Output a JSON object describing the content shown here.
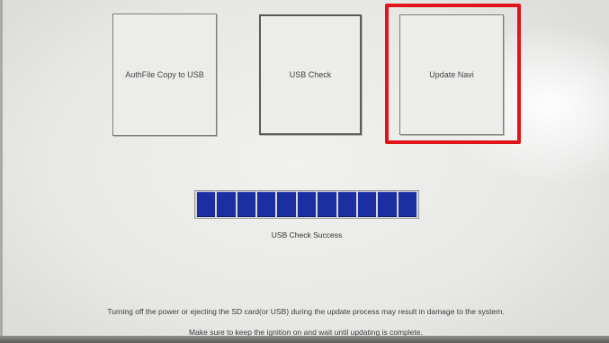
{
  "buttons": {
    "authfile_copy": "AuthFile Copy to USB",
    "usb_check": "USB Check",
    "update_navi": "Update Navi"
  },
  "progress": {
    "segments_filled": 11,
    "segments_total": 11,
    "fill_color": "#1c2fa0"
  },
  "status": {
    "message": "USB Check Success"
  },
  "warnings": {
    "line1": "Turning off the power or ejecting the SD card(or USB) during the update process may result in damage to the system.",
    "line2": "Make sure to keep the ignition on and wait until updating is complete."
  },
  "colors": {
    "highlight": "#e0141a"
  }
}
